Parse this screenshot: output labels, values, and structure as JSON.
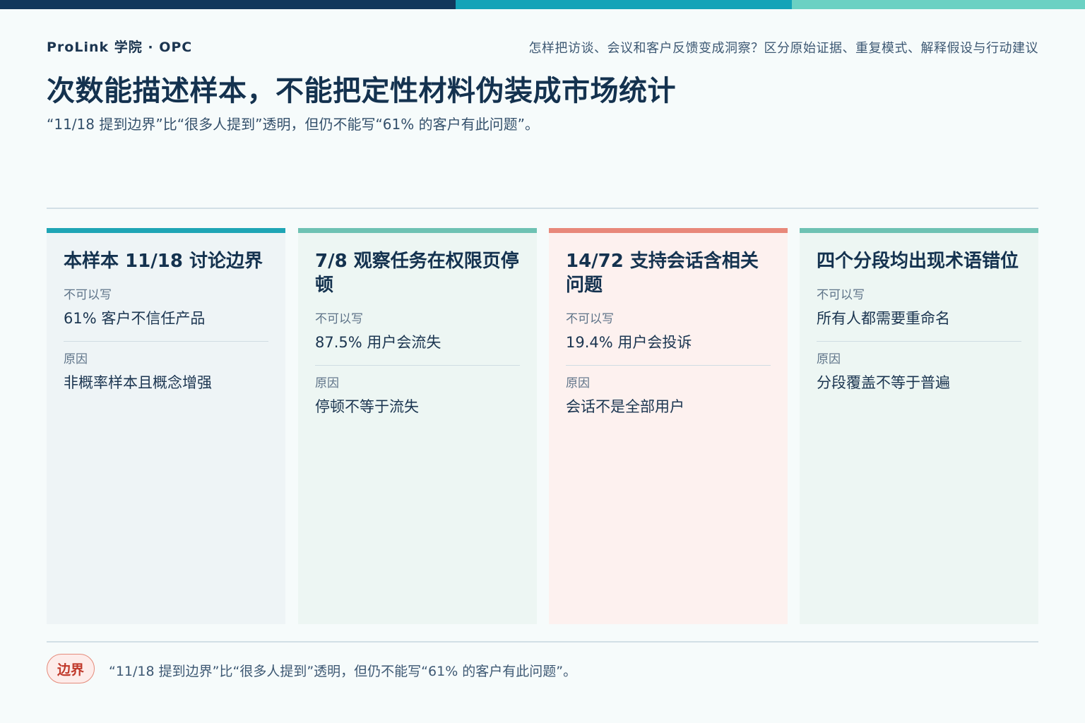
{
  "colors": {
    "background": "#f6fbfb",
    "text_dark": "#14324f",
    "top_bar": [
      "#12385c",
      "#14a3b8",
      "#6bd1c3"
    ]
  },
  "header": {
    "brand": "ProLink 学院 · OPC",
    "question": "怎样把访谈、会议和客户反馈变成洞察？区分原始证据、重复模式、解释假设与行动建议"
  },
  "title": "次数能描述样本，不能把定性材料伪装成市场统计",
  "subtitle": "“11/18 提到边界”比“很多人提到”透明，但仍不能写“61% 的客户有此问题”。",
  "cards": [
    {
      "title": "本样本 11/18 讨论边界",
      "cannot_label": "不可以写",
      "cannot": "61% 客户不信任产品",
      "reason_label": "原因",
      "reason": "非概率样本且概念增强",
      "accent": "#1ea5b5",
      "bg": "#eef4f6"
    },
    {
      "title": "7/8 观察任务在权限页停顿",
      "cannot_label": "不可以写",
      "cannot": "87.5% 用户会流失",
      "reason_label": "原因",
      "reason": "停顿不等于流失",
      "accent": "#6ec2b3",
      "bg": "#edf6f3"
    },
    {
      "title": "14/72 支持会话含相关问题",
      "cannot_label": "不可以写",
      "cannot": "19.4% 用户会投诉",
      "reason_label": "原因",
      "reason": "会话不是全部用户",
      "accent": "#e8887a",
      "bg": "#fdf1ef"
    },
    {
      "title": "四个分段均出现术语错位",
      "cannot_label": "不可以写",
      "cannot": "所有人都需要重命名",
      "reason_label": "原因",
      "reason": "分段覆盖不等于普遍",
      "accent": "#6ec2b3",
      "bg": "#edf6f3"
    }
  ],
  "footer": {
    "badge": "边界",
    "text": "“11/18 提到边界”比“很多人提到”透明，但仍不能写“61% 的客户有此问题”。"
  }
}
